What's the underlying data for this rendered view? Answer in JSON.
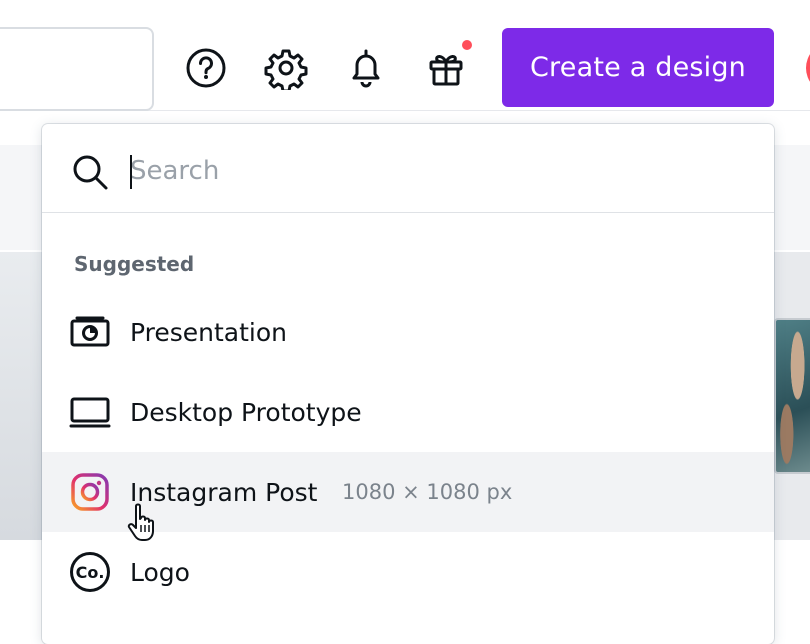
{
  "header": {
    "search_placeholder": "",
    "help_icon": "question-circle-icon",
    "settings_icon": "gear-icon",
    "notifications_icon": "bell-icon",
    "whats_new_icon": "gift-icon",
    "create_button_label": "Create a design"
  },
  "dropdown": {
    "search": {
      "placeholder": "Search",
      "value": ""
    },
    "section_label": "Suggested",
    "items": [
      {
        "label": "Presentation",
        "meta": "",
        "icon": "presentation-icon"
      },
      {
        "label": "Desktop Prototype",
        "meta": "",
        "icon": "monitor-icon"
      },
      {
        "label": "Instagram Post",
        "meta": "1080 × 1080 px",
        "icon": "instagram-icon"
      },
      {
        "label": "Logo",
        "meta": "",
        "icon": "logo-co-icon"
      }
    ]
  },
  "colors": {
    "accent": "#7d2ae8",
    "notification_dot": "#ff4e5a",
    "hover_row": "#f2f3f5"
  }
}
